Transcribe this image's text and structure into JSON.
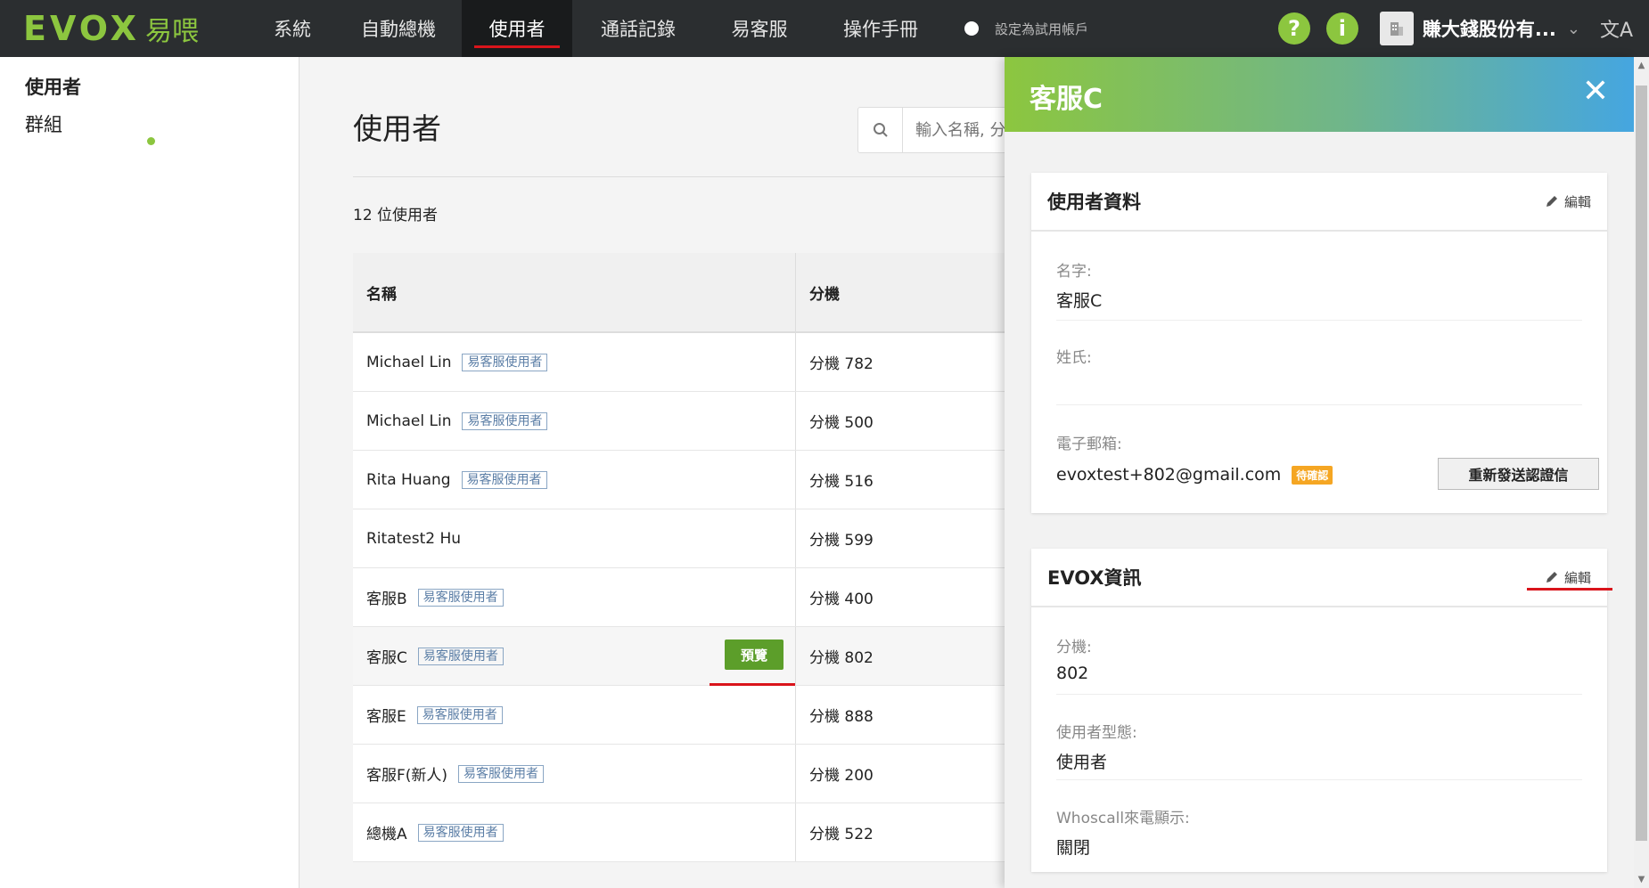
{
  "topbar": {
    "logo_text": "EVOX",
    "logo_cn": "易喂",
    "nav": [
      "系統",
      "自動總機",
      "使用者",
      "通話記錄",
      "易客服",
      "操作手冊"
    ],
    "active_nav": "使用者",
    "trial_toggle_label": "設定為試用帳戶",
    "help_symbol": "?",
    "info_symbol": "i",
    "company_name": "賺大錢股份有...",
    "chevron": "⌄",
    "lang": "文A"
  },
  "sidebar": {
    "items": [
      {
        "label": "使用者"
      },
      {
        "label": "群組"
      }
    ]
  },
  "main": {
    "title": "使用者",
    "search_placeholder": "輸入名稱, 分",
    "count": "12 位使用者",
    "table": {
      "headers": [
        "名稱",
        "分機"
      ],
      "rows": [
        {
          "name": "Michael Lin",
          "tag": "易客服使用者",
          "ext": "分機 782"
        },
        {
          "name": "Michael Lin",
          "tag": "易客服使用者",
          "ext": "分機 500"
        },
        {
          "name": "Rita Huang",
          "tag": "易客服使用者",
          "ext": "分機 516"
        },
        {
          "name": "Ritatest2 Hu",
          "tag": "",
          "ext": "分機 599"
        },
        {
          "name": "客服B",
          "tag": "易客服使用者",
          "ext": "分機 400"
        },
        {
          "name": "客服C",
          "tag": "易客服使用者",
          "ext": "分機 802",
          "action": "預覽"
        },
        {
          "name": "客服E",
          "tag": "易客服使用者",
          "ext": "分機 888"
        },
        {
          "name": "客服F(新人)",
          "tag": "易客服使用者",
          "ext": "分機 200"
        },
        {
          "name": "總機A",
          "tag": "易客服使用者",
          "ext": "分機 522"
        }
      ]
    }
  },
  "panel": {
    "title": "客服C",
    "close_symbol": "✕",
    "user_card": {
      "title": "使用者資料",
      "edit_label": "編輯",
      "first_name_label": "名字:",
      "first_name": "客服C",
      "last_name_label": "姓氏:",
      "last_name": "",
      "email_label": "電子郵箱:",
      "email": "evoxtest+802@gmail.com",
      "email_badge": "待確認",
      "resend_button": "重新發送認證信"
    },
    "evox_card": {
      "title": "EVOX資訊",
      "edit_label": "編輯",
      "ext_label": "分機:",
      "ext": "802",
      "type_label": "使用者型態:",
      "type": "使用者",
      "whoscall_label": "Whoscall來電顯示:",
      "whoscall": "關閉"
    }
  },
  "colors": {
    "brand_green": "#8cc63f",
    "topbar_bg": "#2b2e30",
    "highlight_red": "#d9141b",
    "badge_orange": "#f5a623",
    "preview_green": "#5c9e2a"
  }
}
